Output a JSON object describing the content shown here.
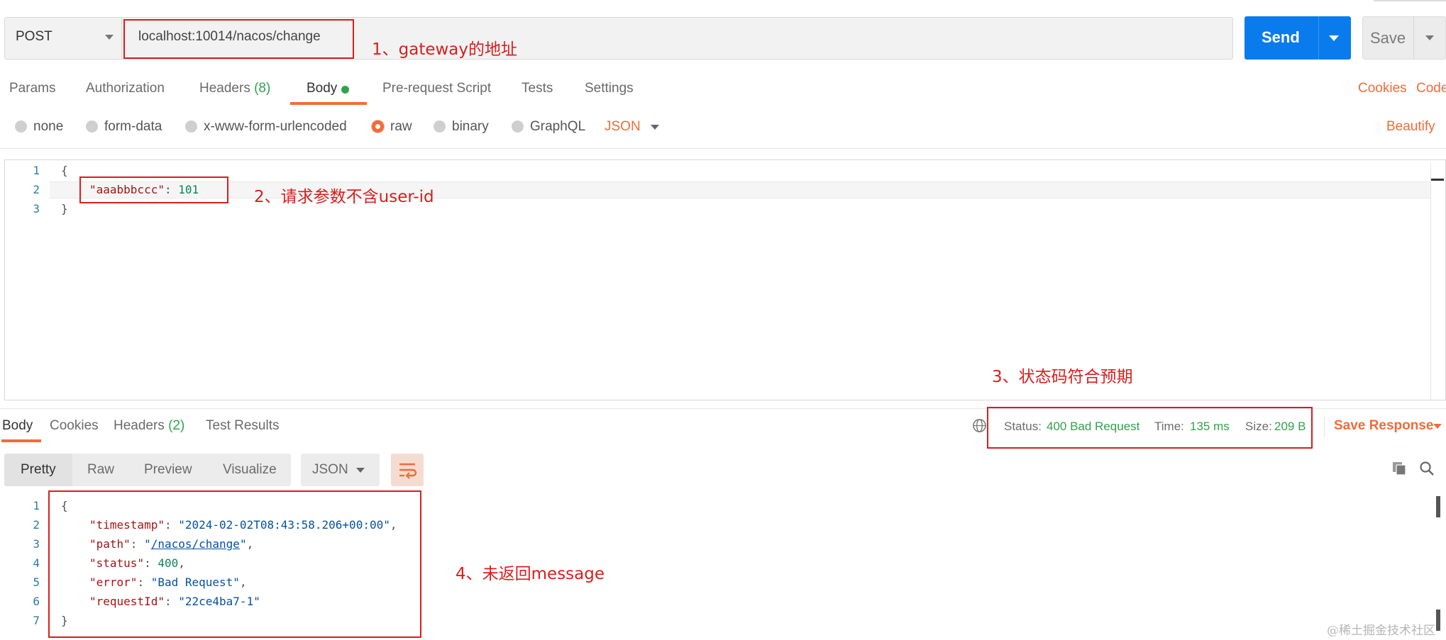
{
  "request": {
    "method": "POST",
    "url": "localhost:10014/nacos/change",
    "send_label": "Send",
    "save_label": "Save"
  },
  "request_tabs": {
    "params": "Params",
    "authorization": "Authorization",
    "headers": "Headers",
    "headers_count": "(8)",
    "body": "Body",
    "prerequest": "Pre-request Script",
    "tests": "Tests",
    "settings": "Settings",
    "cookies": "Cookies",
    "code": "Code"
  },
  "body_types": {
    "none": "none",
    "form_data": "form-data",
    "urlencoded": "x-www-form-urlencoded",
    "raw": "raw",
    "binary": "binary",
    "graphql": "GraphQL",
    "format": "JSON",
    "beautify": "Beautify",
    "selected": "raw"
  },
  "request_body": {
    "line_numbers": [
      "1",
      "2",
      "3"
    ],
    "open_brace": "{",
    "key": "\"aaabbbccc\"",
    "colon": ": ",
    "value": "101",
    "close_brace": "}"
  },
  "response_tabs": {
    "body": "Body",
    "cookies": "Cookies",
    "headers": "Headers",
    "headers_count": "(2)",
    "test_results": "Test Results"
  },
  "response_status": {
    "status_label": "Status:",
    "status_value": "400 Bad Request",
    "time_label": "Time:",
    "time_value": "135 ms",
    "size_label": "Size:",
    "size_value": "209 B",
    "save_response": "Save Response"
  },
  "response_toolbar": {
    "pretty": "Pretty",
    "raw": "Raw",
    "preview": "Preview",
    "visualize": "Visualize",
    "format": "JSON"
  },
  "response_body": {
    "line_numbers": [
      "1",
      "2",
      "3",
      "4",
      "5",
      "6",
      "7"
    ],
    "open_brace": "{",
    "lines": [
      {
        "key": "\"timestamp\"",
        "value": "\"2024-02-02T08:43:58.206+00:00\"",
        "trail": ","
      },
      {
        "key": "\"path\"",
        "value_prefix": "\"",
        "link": "/nacos/change",
        "value_suffix": "\"",
        "trail": ","
      },
      {
        "key": "\"status\"",
        "value": "400",
        "trail": ","
      },
      {
        "key": "\"error\"",
        "value": "\"Bad Request\"",
        "trail": ","
      },
      {
        "key": "\"requestId\"",
        "value": "\"22ce4ba7-1\"",
        "trail": ""
      }
    ],
    "close_brace": "}"
  },
  "annotations": {
    "a1": "1、gateway的地址",
    "a2": "2、请求参数不含user-id",
    "a3": "3、状态码符合预期",
    "a4": "4、未返回message"
  },
  "watermark": "@稀土掘金技术社区",
  "colors": {
    "accent": "#f26b3a",
    "send": "#097bed",
    "success": "#31a24c",
    "annotation": "#d81e1e"
  },
  "icons": [
    "globe-icon",
    "copy-icon",
    "search-icon",
    "wrap-lines-icon",
    "chevron-down-icon"
  ]
}
